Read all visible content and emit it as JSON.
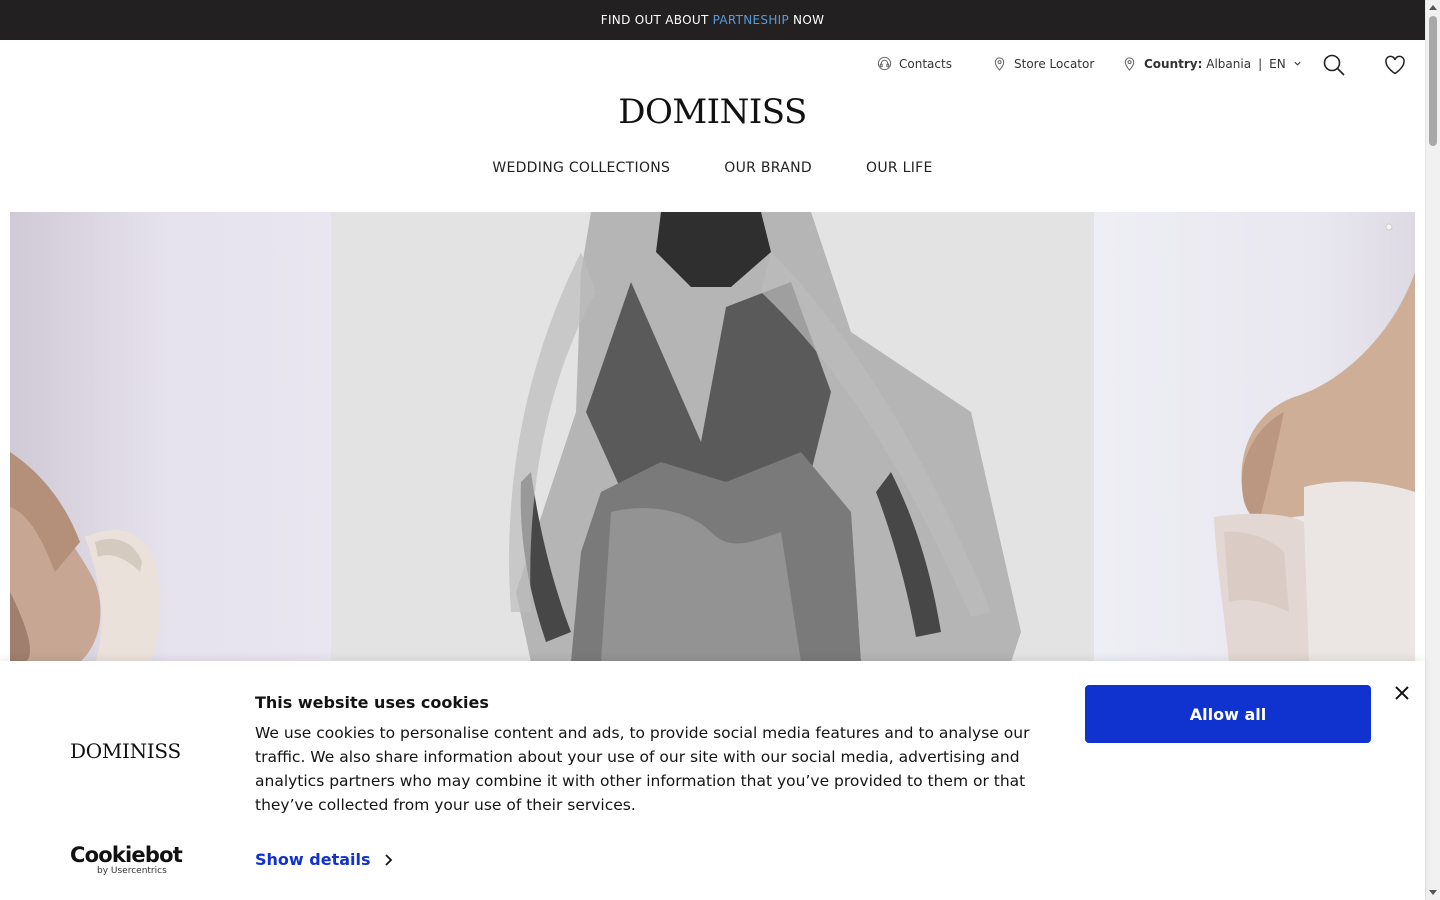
{
  "announcement": {
    "prefix": "FIND OUT ABOUT",
    "link": "PARTNESHIP",
    "suffix": "NOW"
  },
  "utility": {
    "contacts": "Contacts",
    "store_locator": "Store Locator",
    "country_label": "Country:",
    "country_value": "Albania",
    "separator": "|",
    "language": "EN"
  },
  "brand": {
    "logo": "DOMINISS"
  },
  "nav": {
    "items": [
      "WEDDING COLLECTIONS",
      "OUR BRAND",
      "OUR LIFE"
    ]
  },
  "cookie_banner": {
    "logo": "DOMINISS",
    "title": "This website uses cookies",
    "body": "We use cookies to personalise content and ads, to provide social media features and to analyse our traffic. We also share information about your use of our site with our social media, advertising and analytics partners who may combine it with other information that you’ve provided to them or that they’ve collected from your use of their services.",
    "show_details": "Show details",
    "allow_all": "Allow all",
    "provider": "Cookiebot",
    "provider_sub": "by Usercentrics"
  },
  "colors": {
    "accent_blue": "#1032cf",
    "announce_bg": "#222021",
    "announce_link": "#5b9ad8"
  },
  "icons": [
    "headset-icon",
    "location-pin-icon",
    "search-icon",
    "heart-icon",
    "chevron-down-icon",
    "close-icon",
    "chevron-right-icon"
  ]
}
